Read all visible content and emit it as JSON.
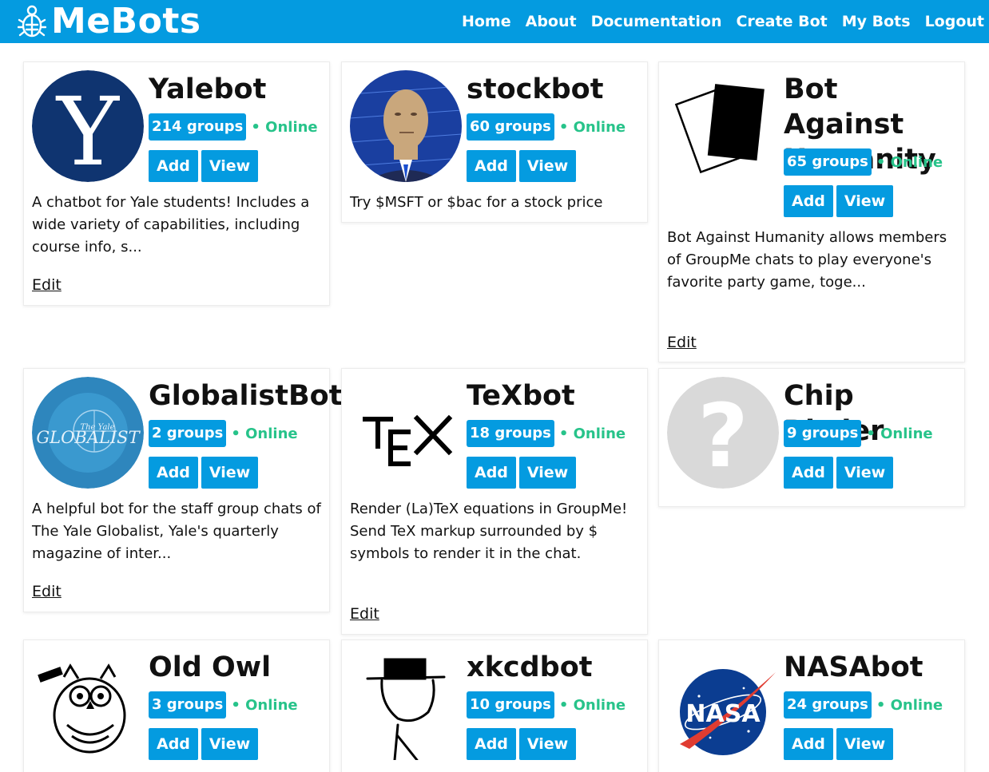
{
  "brand": {
    "name": "MeBots",
    "accent": "#049be0",
    "online_color": "#27c38a"
  },
  "nav": {
    "home": "Home",
    "about": "About",
    "documentation": "Documentation",
    "create_bot": "Create Bot",
    "my_bots": "My Bots",
    "logout": "Logout"
  },
  "bots": [
    {
      "name": "Yalebot",
      "groups": "214 groups",
      "status": "• Online",
      "add": "Add",
      "view": "View",
      "description": "A chatbot for Yale students! Includes a wide variety of capabilities, including course info, s...",
      "edit": "Edit",
      "avatar_text": "Y"
    },
    {
      "name": "stockbot",
      "groups": "60 groups",
      "status": "• Online",
      "add": "Add",
      "view": "View",
      "description": "Try $MSFT or $bac for a stock price"
    },
    {
      "name": "Bot Against Humanity",
      "groups": "65 groups",
      "status": "• Online",
      "add": "Add",
      "view": "View",
      "description": "Bot Against Humanity allows members of GroupMe chats to play everyone's favorite party game, toge...",
      "edit": "Edit"
    },
    {
      "name": "GlobalistBot",
      "groups": "2 groups",
      "status": "• Online",
      "add": "Add",
      "view": "View",
      "description": "A helpful bot for the staff group chats of The Yale Globalist, Yale's quarterly magazine of inter...",
      "edit": "Edit",
      "avatar_top": "The Yale",
      "avatar_text": "GLOBALIST"
    },
    {
      "name": "TeXbot",
      "groups": "18 groups",
      "status": "• Online",
      "add": "Add",
      "view": "View",
      "description": "Render (La)TeX equations in GroupMe! Send TeX markup surrounded by $ symbols to render it in the chat.",
      "edit": "Edit"
    },
    {
      "name": "Chip Rittler",
      "groups": "9 groups",
      "status": "• Online",
      "add": "Add",
      "view": "View",
      "avatar_text": "?"
    },
    {
      "name": "Old Owl",
      "groups": "3 groups",
      "status": "• Online",
      "add": "Add",
      "view": "View"
    },
    {
      "name": "xkcdbot",
      "groups": "10 groups",
      "status": "• Online",
      "add": "Add",
      "view": "View"
    },
    {
      "name": "NASAbot",
      "groups": "24 groups",
      "status": "• Online",
      "add": "Add",
      "view": "View",
      "avatar_text": "NASA"
    }
  ]
}
